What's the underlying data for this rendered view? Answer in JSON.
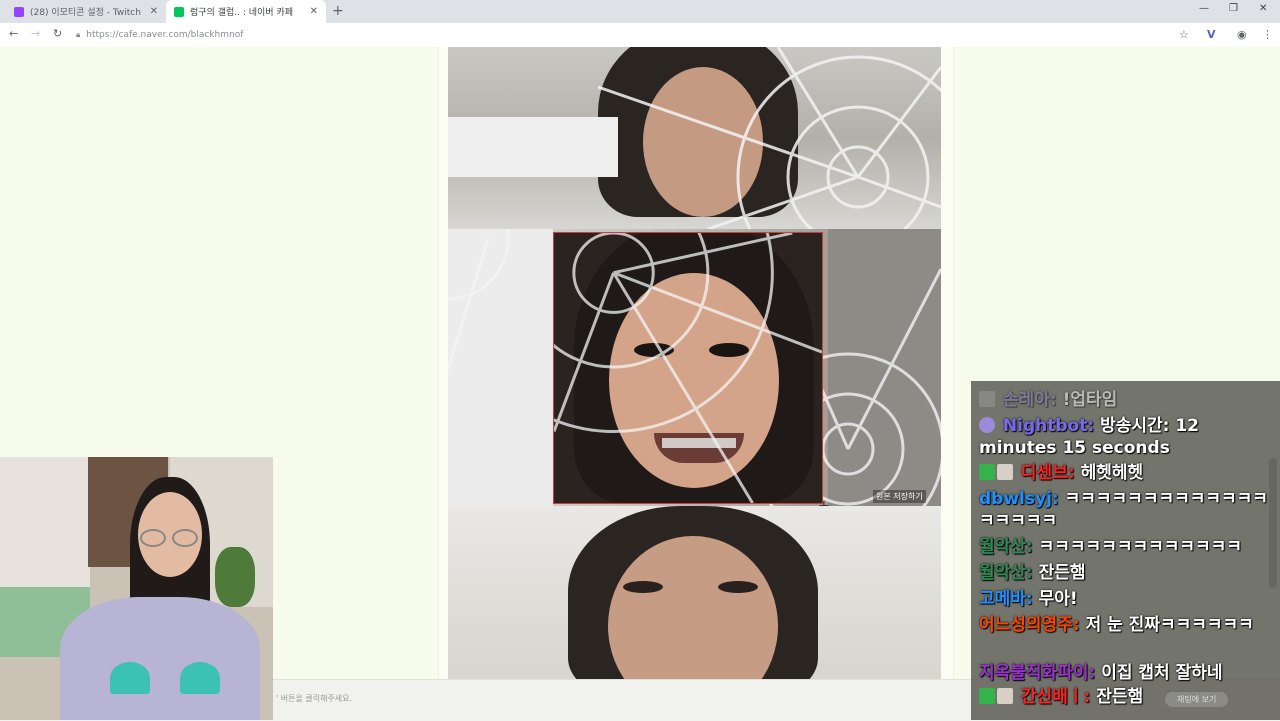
{
  "tabs": [
    {
      "title": "(28) 이모티콘 설정 - Twitch",
      "favicon_color": "#9146ff",
      "active": false
    },
    {
      "title": "럼구의 갤럽.. : 네이버 카페",
      "favicon_color": "#03c75a",
      "active": true
    }
  ],
  "url": "https://cafe.naver.com/blackhmnof",
  "page": {
    "save_hint": "원본 저장하기",
    "bottom_hint": "' 버튼을 클릭해주세요."
  },
  "chat": {
    "messages": [
      {
        "user": "손레아:",
        "text": "!업타임",
        "color": "#8a7fc2",
        "dim": true
      },
      {
        "user": "Nightbot:",
        "text": "방송시간: 12 minutes 15 seconds",
        "color": "#7b68ee"
      },
      {
        "user": "디센브:",
        "text": "헤헷헤헷",
        "color": "#ff2020"
      },
      {
        "user": "dbwlsyj:",
        "text": "ㅋㅋㅋㅋㅋㅋㅋㅋㅋㅋㅋㅋㅋㅋㅋㅋㅋㅋ",
        "color": "#1e90ff"
      },
      {
        "user": "월악산:",
        "text": "ㅋㅋㅋㅋㅋㅋㅋㅋㅋㅋㅋㅋㅋ",
        "color": "#2e8b57"
      },
      {
        "user": "월악산:",
        "text": "잔든햄",
        "color": "#2e8b57"
      },
      {
        "user": "고메바:",
        "text": "무아!",
        "color": "#1e90ff"
      },
      {
        "user": "어느성의영주:",
        "text": "저 눈 진짜ㅋㅋㅋㅋㅋㅋ",
        "color": "#ff4500"
      },
      {
        "user": "지옥불직화파이:",
        "text": "이집 캡처 잘하네",
        "color": "#9932cc"
      },
      {
        "user": "간신배ㅣ:",
        "text": "잔든햄",
        "color": "#ff2020"
      }
    ],
    "footer_label": "채팅에 보기"
  },
  "colors": {
    "page_bg": "#f7fbec",
    "chat_bg": "#4e4e46",
    "selection_border": "#d43b3b"
  }
}
